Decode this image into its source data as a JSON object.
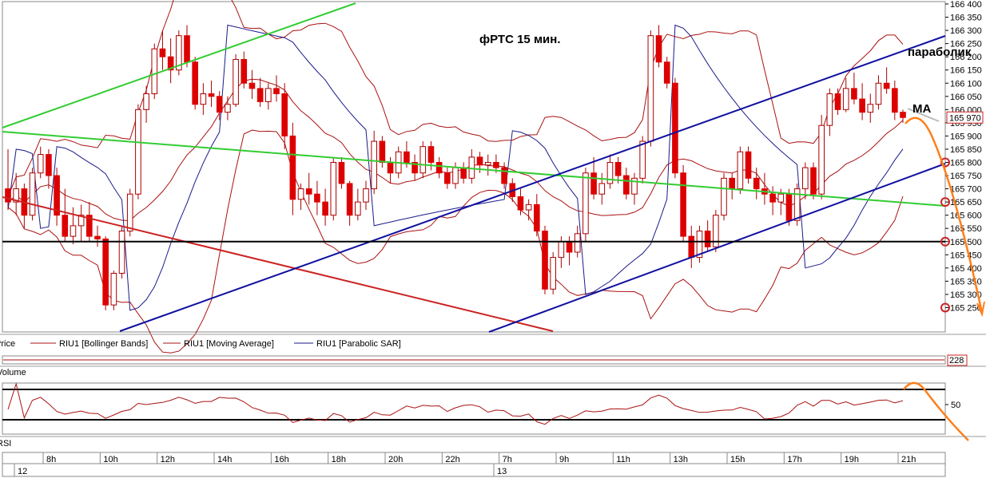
{
  "chart_data": {
    "type": "candlestick",
    "title": "фРТС   15 мин.",
    "ylim": [
      165200,
      166400
    ],
    "y_ticks": [
      "166 400",
      "166 350",
      "166 300",
      "166 250",
      "166 200",
      "166 150",
      "166 100",
      "166 050",
      "166 000",
      "165 950",
      "165 900",
      "165 850",
      "165 800",
      "165 750",
      "165 700",
      "165 650",
      "165 600",
      "165 550",
      "165 500",
      "165 450",
      "165 400",
      "165 350",
      "165 300",
      "165 250"
    ],
    "last_price_label": "165 970",
    "volume_value_label": "228",
    "rsi_tick_label": "50",
    "legend": {
      "price": "Price",
      "bollinger": "RIU1 [Bollinger Bands]",
      "moving_average": "RIU1 [Moving Average]",
      "parabolic_sar": "RIU1 [Parabolic SAR]",
      "volume": "Volume",
      "rsi": "RSI"
    },
    "annotations": {
      "parabolic": "параболик",
      "ma": "MA"
    },
    "x_time_labels": [
      "8h",
      "10h",
      "12h",
      "14h",
      "16h",
      "18h",
      "20h",
      "22h",
      "7h",
      "9h",
      "11h",
      "13h",
      "15h",
      "17h",
      "19h",
      "21h"
    ],
    "x_day_labels": [
      "12",
      "13"
    ],
    "horizontal_level": 165500,
    "circled_levels": [
      165800,
      165650,
      165500,
      165250
    ],
    "trend_lines": [
      {
        "color": "#1f9e1f",
        "name": "green-up"
      },
      {
        "color": "#33cc33",
        "name": "green-down"
      },
      {
        "color": "#cc2222",
        "name": "red-down"
      },
      {
        "color": "#1010a0",
        "name": "blue-channel-lower"
      },
      {
        "color": "#1010a0",
        "name": "blue-channel-upper"
      },
      {
        "color": "#1010a0",
        "name": "blue-lower-2"
      }
    ],
    "colors": {
      "up": "#ffffff",
      "down": "#dd0000",
      "wick": "#aa0000",
      "bands": "#aa1111",
      "sar": "#1a1a8a",
      "forecast": "#ff7f1a"
    },
    "candles": [
      [
        165700,
        165850,
        165620,
        165650
      ],
      [
        165650,
        165760,
        165600,
        165700
      ],
      [
        165700,
        165720,
        165550,
        165600
      ],
      [
        165600,
        165780,
        165580,
        165760
      ],
      [
        165760,
        165860,
        165740,
        165830
      ],
      [
        165830,
        165850,
        165700,
        165750
      ],
      [
        165750,
        165780,
        165560,
        165600
      ],
      [
        165600,
        165700,
        165500,
        165520
      ],
      [
        165520,
        165630,
        165490,
        165560
      ],
      [
        165560,
        165640,
        165500,
        165600
      ],
      [
        165600,
        165650,
        165500,
        165520
      ],
      [
        165520,
        165560,
        165480,
        165510
      ],
      [
        165510,
        165520,
        165240,
        165260
      ],
      [
        165260,
        165390,
        165240,
        165380
      ],
      [
        165380,
        165560,
        165360,
        165540
      ],
      [
        165540,
        165700,
        165520,
        165680
      ],
      [
        165680,
        166020,
        165660,
        166000
      ],
      [
        166000,
        166090,
        165950,
        166060
      ],
      [
        166060,
        166250,
        166040,
        166230
      ],
      [
        166230,
        166300,
        166150,
        166200
      ],
      [
        166200,
        166270,
        166100,
        166150
      ],
      [
        166150,
        166300,
        166130,
        166280
      ],
      [
        166280,
        166320,
        166160,
        166180
      ],
      [
        166180,
        166200,
        166000,
        166020
      ],
      [
        166020,
        166100,
        165980,
        166060
      ],
      [
        166060,
        166110,
        166010,
        166050
      ],
      [
        166050,
        166070,
        165960,
        165990
      ],
      [
        165990,
        166050,
        165960,
        166020
      ],
      [
        166020,
        166210,
        166010,
        166190
      ],
      [
        166190,
        166220,
        166080,
        166100
      ],
      [
        166100,
        166150,
        166040,
        166080
      ],
      [
        166080,
        166120,
        166010,
        166030
      ],
      [
        166030,
        166100,
        166000,
        166080
      ],
      [
        166080,
        166130,
        166030,
        166060
      ],
      [
        166060,
        166100,
        165850,
        165900
      ],
      [
        165900,
        165950,
        165600,
        165660
      ],
      [
        165660,
        165720,
        165620,
        165700
      ],
      [
        165700,
        165760,
        165640,
        165680
      ],
      [
        165680,
        165730,
        165600,
        165650
      ],
      [
        165650,
        165700,
        165560,
        165600
      ],
      [
        165600,
        165820,
        165580,
        165800
      ],
      [
        165800,
        165820,
        165700,
        165720
      ],
      [
        165720,
        165730,
        165560,
        165600
      ],
      [
        165600,
        165700,
        165580,
        165650
      ],
      [
        165650,
        165730,
        165620,
        165700
      ],
      [
        165700,
        165920,
        165680,
        165880
      ],
      [
        165880,
        165900,
        165780,
        165800
      ],
      [
        165800,
        165820,
        165720,
        165760
      ],
      [
        165760,
        165860,
        165740,
        165840
      ],
      [
        165840,
        165880,
        165780,
        165800
      ],
      [
        165800,
        165830,
        165730,
        165760
      ],
      [
        165760,
        165880,
        165740,
        165860
      ],
      [
        165860,
        165880,
        165770,
        165800
      ],
      [
        165800,
        165820,
        165740,
        165760
      ],
      [
        165760,
        165780,
        165700,
        165720
      ],
      [
        165720,
        165800,
        165700,
        165780
      ],
      [
        165780,
        165800,
        165720,
        165740
      ],
      [
        165740,
        165850,
        165720,
        165820
      ],
      [
        165820,
        165840,
        165760,
        165790
      ],
      [
        165790,
        165830,
        165750,
        165800
      ],
      [
        165800,
        165830,
        165760,
        165780
      ],
      [
        165780,
        165800,
        165700,
        165720
      ],
      [
        165720,
        165740,
        165650,
        165670
      ],
      [
        165670,
        165700,
        165600,
        165620
      ],
      [
        165620,
        165660,
        165580,
        165640
      ],
      [
        165640,
        165680,
        165520,
        165540
      ],
      [
        165540,
        165560,
        165300,
        165320
      ],
      [
        165320,
        165460,
        165300,
        165440
      ],
      [
        165440,
        165520,
        165400,
        165500
      ],
      [
        165500,
        165520,
        165410,
        165460
      ],
      [
        165460,
        165560,
        165440,
        165530
      ],
      [
        165530,
        165780,
        165500,
        165760
      ],
      [
        165760,
        165820,
        165660,
        165680
      ],
      [
        165680,
        165760,
        165640,
        165720
      ],
      [
        165720,
        165830,
        165700,
        165800
      ],
      [
        165800,
        165820,
        165720,
        165750
      ],
      [
        165750,
        165780,
        165660,
        165680
      ],
      [
        165680,
        165760,
        165640,
        165740
      ],
      [
        165740,
        165900,
        165720,
        165880
      ],
      [
        165880,
        166300,
        165860,
        166280
      ],
      [
        166280,
        166320,
        166160,
        166180
      ],
      [
        166180,
        166200,
        166080,
        166100
      ],
      [
        166100,
        166120,
        165740,
        165760
      ],
      [
        165760,
        165790,
        165500,
        165520
      ],
      [
        165520,
        165560,
        165400,
        165440
      ],
      [
        165440,
        165560,
        165420,
        165540
      ],
      [
        165540,
        165580,
        165460,
        165480
      ],
      [
        165480,
        165620,
        165460,
        165600
      ],
      [
        165600,
        165760,
        165580,
        165740
      ],
      [
        165740,
        165760,
        165660,
        165700
      ],
      [
        165700,
        165860,
        165680,
        165840
      ],
      [
        165840,
        165860,
        165720,
        165740
      ],
      [
        165740,
        165780,
        165660,
        165700
      ],
      [
        165700,
        165760,
        165640,
        165680
      ],
      [
        165680,
        165710,
        165600,
        165650
      ],
      [
        165650,
        165700,
        165600,
        165680
      ],
      [
        165680,
        165700,
        165560,
        165580
      ],
      [
        165580,
        165720,
        165560,
        165700
      ],
      [
        165700,
        165800,
        165660,
        165780
      ],
      [
        165780,
        165800,
        165660,
        165680
      ],
      [
        165680,
        165980,
        165660,
        165940
      ],
      [
        165940,
        166080,
        165900,
        166060
      ],
      [
        166060,
        166080,
        165980,
        166000
      ],
      [
        166000,
        166120,
        165990,
        166080
      ],
      [
        166080,
        166140,
        166020,
        166040
      ],
      [
        166040,
        166100,
        165960,
        165990
      ],
      [
        165990,
        166060,
        165950,
        166020
      ],
      [
        166020,
        166130,
        166000,
        166100
      ],
      [
        166100,
        166160,
        166060,
        166080
      ],
      [
        166080,
        166110,
        165960,
        165990
      ],
      [
        165990,
        166000,
        165950,
        165970
      ]
    ]
  }
}
